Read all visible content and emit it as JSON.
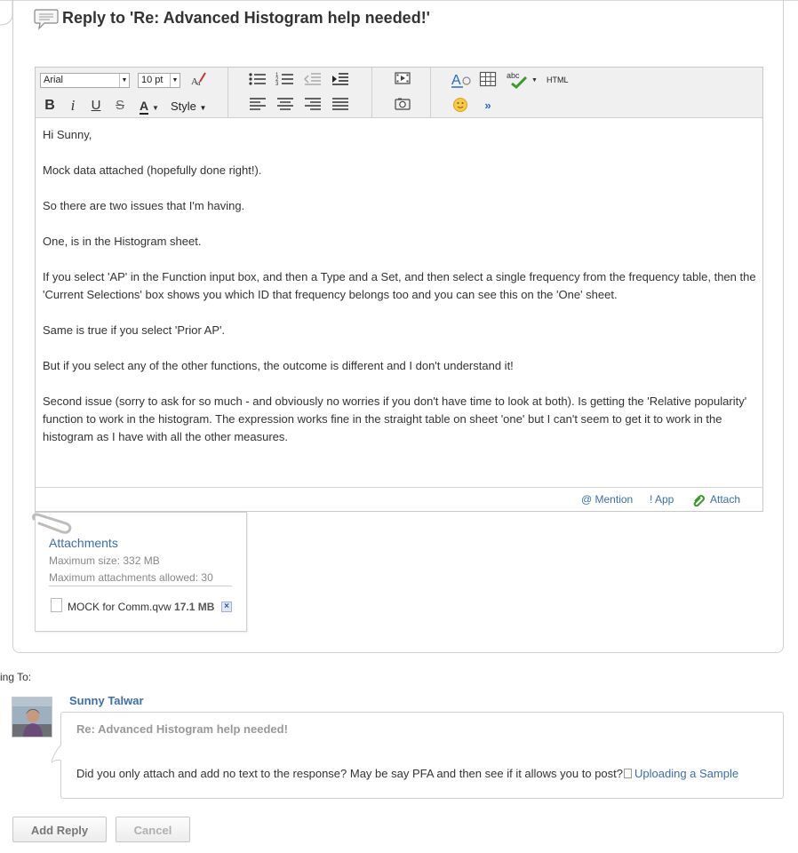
{
  "reply": {
    "title": "Reply to 'Re: Advanced Histogram help needed!'"
  },
  "toolbar": {
    "font_family": "Arial",
    "font_size": "10 pt",
    "style_label": "Style",
    "html_label": "HTML",
    "abc_label": "abc"
  },
  "editor": {
    "paragraphs": [
      "Hi Sunny,",
      "Mock data attached (hopefully done right!).",
      "So there are two issues that I'm having.",
      "One, is in the Histogram sheet.",
      "If you select 'AP' in the Function input box, and then a Type and a Set, and then select a single frequency from the frequency table, then the 'Current Selections' box shows you which ID that frequency belongs too and you can see this on the 'One' sheet.",
      "Same is true if you select 'Prior AP'.",
      "But if you select any of the other functions, the outcome is different and I don't understand it!",
      "Second issue (sorry to ask for so much - and obviously no worries if you don't have time to look at both). Is getting the 'Relative popularity' function to work in the histogram. The expression works fine in the straight table on sheet 'one' but I can't seem to get it to work in the histogram as I have with all the other measures."
    ],
    "footer": {
      "mention": "@ Mention",
      "app": "! App",
      "attach": "Attach"
    }
  },
  "attachments": {
    "title": "Attachments",
    "max_size": "Maximum size: 332 MB",
    "max_count": "Maximum attachments allowed: 30",
    "file_name": "MOCK for Comm.qvw",
    "file_size": "17.1 MB"
  },
  "replying": {
    "label": "ing To:",
    "author": "Sunny Talwar",
    "title": "Re: Advanced Histogram help needed!",
    "text": "Did you only attach and add no text to the response? May be say PFA and then see if it allows you to post?",
    "link": "Uploading a Sample"
  },
  "buttons": {
    "add_reply": "Add Reply",
    "cancel": "Cancel"
  },
  "colors": {
    "link": "#3a6fae",
    "border": "#cfcfcf",
    "toolbar_bg": "#f0f0f0"
  }
}
